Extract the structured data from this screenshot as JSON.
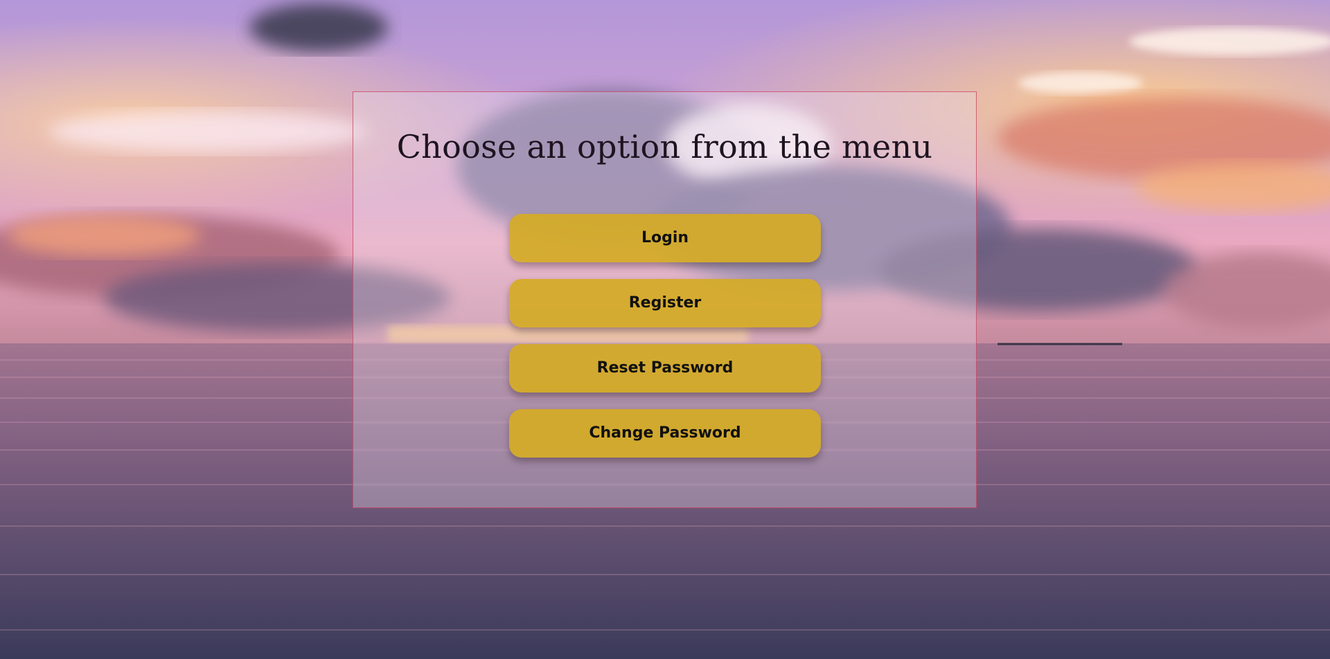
{
  "background": {
    "description_colors": {
      "sky_top": "#b79ad8",
      "sky_mid": "#e7a9c7",
      "sky_glow": "#f3b48c",
      "horizon": "#8c6a8e",
      "sea_top": "#9a6f8a",
      "sea_bottom": "#3d3b5a"
    }
  },
  "menu_panel": {
    "title": "Choose an option from the menu",
    "buttons": [
      {
        "label": "Login"
      },
      {
        "label": "Register"
      },
      {
        "label": "Reset Password"
      },
      {
        "label": "Change Password"
      }
    ],
    "button_color": "#d4ab28",
    "border_color": "#c83c5a"
  }
}
